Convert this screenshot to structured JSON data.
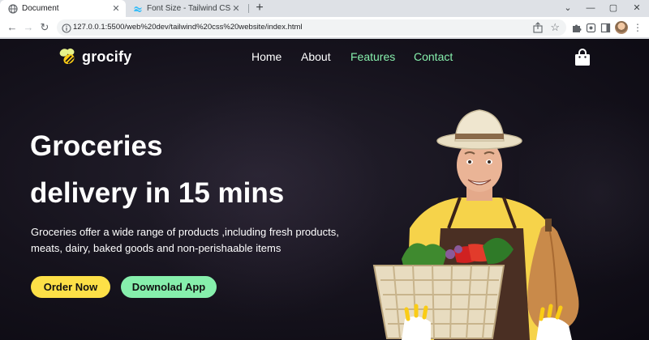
{
  "browser": {
    "tabs": [
      {
        "title": "Document",
        "active": true
      },
      {
        "title": "Font Size - Tailwind CSS",
        "active": false
      }
    ],
    "url": "127.0.0.1:5500/web%20dev/tailwind%20css%20website/index.html",
    "window_controls": {
      "minimize": "—",
      "maximize": "▢",
      "close": "✕"
    }
  },
  "site": {
    "logo": "grocify",
    "nav": {
      "home": "Home",
      "about": "About",
      "features": "Features",
      "contact": "Contact"
    },
    "hero": {
      "title_line1": "Groceries",
      "title_line2": "delivery in 15 mins",
      "description": "Groceries offer a wide range of products ,including fresh products, meats, dairy, baked goods and non-perishaable items",
      "order_button": "Order Now",
      "download_button": "Downolad App"
    }
  },
  "colors": {
    "accent_yellow": "#fde047",
    "accent_green": "#86efac",
    "background": "#15121c"
  },
  "icons": [
    "globe-icon",
    "tailwind-icon",
    "close-icon",
    "new-tab-icon",
    "back-icon",
    "forward-icon",
    "reload-icon",
    "info-icon",
    "share-icon",
    "star-icon",
    "extensions-icon",
    "media-icon",
    "side-panel-icon",
    "menu-icon",
    "bee-icon",
    "shopping-bag-icon"
  ]
}
